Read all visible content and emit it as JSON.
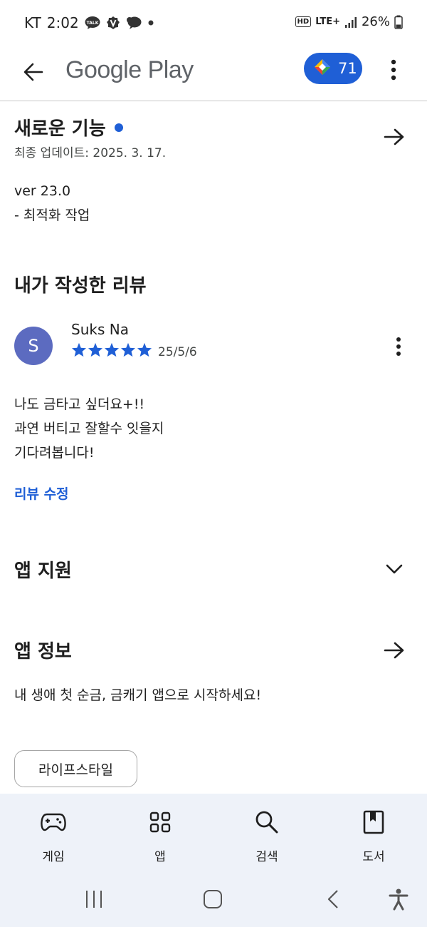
{
  "status_bar": {
    "carrier": "KT",
    "time": "2:02",
    "hd_label": "HD",
    "network": "LTE+",
    "battery": "26%",
    "notification_icons": [
      "talk-icon",
      "v-icon",
      "chat-bubble-icon",
      "dot-icon"
    ]
  },
  "app_bar": {
    "title": "Google Play",
    "points": "71",
    "accent_color": "#1f5fd6"
  },
  "whats_new": {
    "title": "새로운 기능",
    "updated": "최종 업데이트: 2025. 3. 17.",
    "version": "ver 23.0",
    "note": "- 최적화 작업"
  },
  "my_review": {
    "title": "내가 작성한 리뷰",
    "avatar_letter": "S",
    "reviewer_name": "Suks Na",
    "rating": 5,
    "date": "25/5/6",
    "lines": [
      "나도 금타고 싶더요+!!",
      "과연 버티고 잘할수 잇을지",
      "기다려봅니다!"
    ],
    "edit_link": "리뷰 수정"
  },
  "app_support": {
    "title": "앱 지원"
  },
  "app_info": {
    "title": "앱 정보",
    "description": "내 생애 첫 순금, 금캐기 앱으로 시작하세요!",
    "category": "라이프스타일"
  },
  "bottom_nav": {
    "items": [
      {
        "label": "게임",
        "icon": "gamepad-icon"
      },
      {
        "label": "앱",
        "icon": "apps-grid-icon"
      },
      {
        "label": "검색",
        "icon": "search-icon"
      },
      {
        "label": "도서",
        "icon": "book-icon"
      }
    ]
  },
  "system_nav": {
    "buttons": [
      "recents-icon",
      "home-icon",
      "back-icon",
      "accessibility-icon"
    ]
  }
}
